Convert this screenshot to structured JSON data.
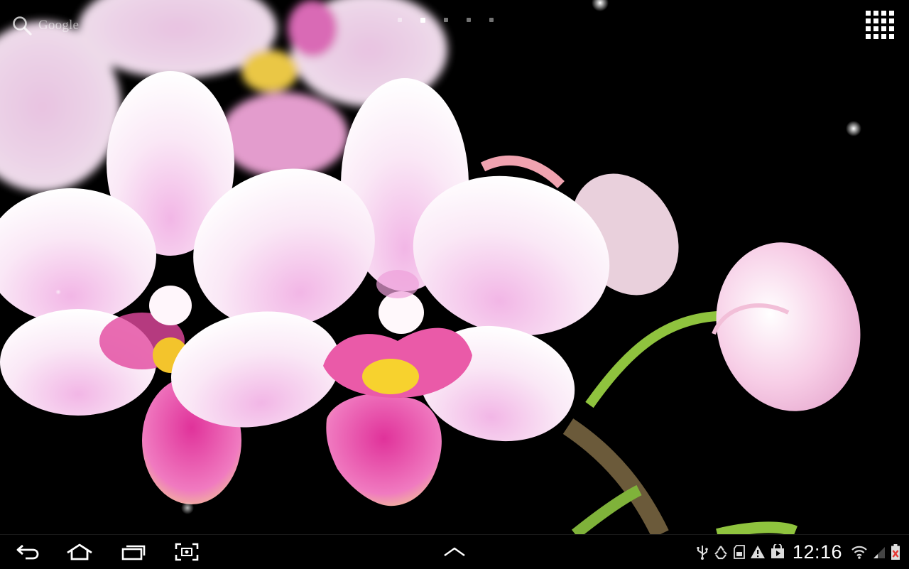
{
  "homescreen": {
    "search_label": "Google",
    "page_count": 5,
    "active_page": 2
  },
  "status_bar": {
    "time": "12:16"
  },
  "icons": {
    "search": "search-icon",
    "all_apps": "all-apps-grid-icon",
    "back": "back-icon",
    "home": "home-icon",
    "recents": "recent-apps-icon",
    "screenshot": "screenshot-icon",
    "menu_up": "chevron-up-icon",
    "usb": "usb-icon",
    "recycle": "recycle-icon",
    "sd_card": "sd-card-icon",
    "warning": "warning-icon",
    "play_store": "play-store-icon",
    "wifi": "wifi-icon",
    "signal": "signal-icon",
    "battery": "battery-icon"
  },
  "colors": {
    "background": "#000000",
    "accent": "#33b5e5",
    "battery_alert": "#e53935"
  }
}
